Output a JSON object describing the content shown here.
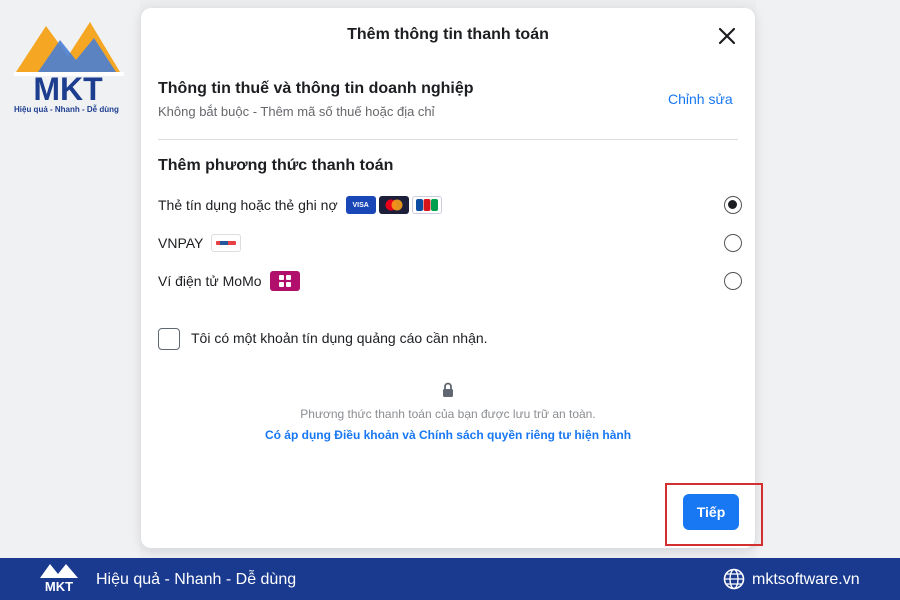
{
  "brand": {
    "logo_text": "MKT",
    "tagline": "Hiệu quả - Nhanh - Dễ dùng",
    "primary_color": "#1a3a8f",
    "accent_color": "#f5a623"
  },
  "modal": {
    "title": "Thêm thông tin thanh toán",
    "close_icon": "close-icon",
    "tax_section": {
      "title": "Thông tin thuế và thông tin doanh nghiệp",
      "subtitle": "Không bắt buộc - Thêm mã số thuế hoặc địa chỉ",
      "edit_label": "Chỉnh sửa"
    },
    "payment_section": {
      "title": "Thêm phương thức thanh toán",
      "methods": [
        {
          "label": "Thẻ tín dụng hoặc thẻ ghi nợ",
          "selected": true,
          "icons": [
            "VISA",
            "mastercard",
            "JCB"
          ]
        },
        {
          "label": "VNPAY",
          "selected": false,
          "icons": [
            "VNPAY"
          ]
        },
        {
          "label": "Ví điện tử MoMo",
          "selected": false,
          "icons": [
            "mo mo"
          ]
        }
      ]
    },
    "ad_credit_label": "Tôi có một khoản tín dụng quảng cáo cần nhận.",
    "secure_text": "Phương thức thanh toán của bạn được lưu trữ an toàn.",
    "terms_link": "Có áp dụng Điều khoản và Chính sách quyền riêng tư hiện hành",
    "next_label": "Tiếp",
    "accent_color": "#1877f2"
  },
  "footer": {
    "slogan": "Hiệu quả - Nhanh - Dễ dùng",
    "website": "mktsoftware.vn"
  }
}
